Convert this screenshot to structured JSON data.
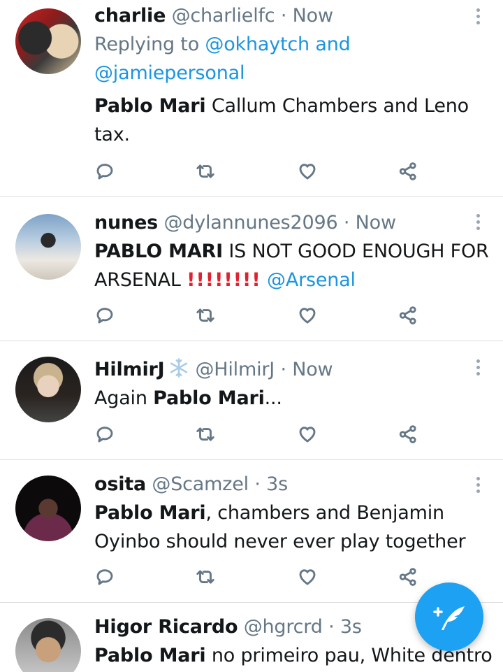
{
  "colors": {
    "accent": "#1da1f2",
    "link": "#1b95e0",
    "secondary": "#657786",
    "alert": "#e0212e"
  },
  "tweets": [
    {
      "name": "charlie",
      "handle": "@charlielfc",
      "time": "Now",
      "reply_prefix": "Replying to",
      "reply_to_1": "@okhaytch",
      "reply_and": "and",
      "reply_to_2": "@jamiepersonal",
      "bold": "Pablo Mari",
      "body_1": "Callum Chambers and Leno",
      "body_2": "tax."
    },
    {
      "name": "nunes",
      "handle": "@dylannunes2096",
      "time": "Now",
      "bold": "PABLO MARI",
      "body_1": "IS NOT GOOD ENOUGH FOR",
      "body_2": "ARSENAL",
      "excl": "!!!!!!!!",
      "mention": "@Arsenal"
    },
    {
      "name": "HilmirJ",
      "handle": "@HilmirJ",
      "time": "Now",
      "body_pre": "Again",
      "bold": "Pablo Mari",
      "body_post": "..."
    },
    {
      "name": "osita",
      "handle": "@Scamzel",
      "time": "3s",
      "bold": "Pablo Mari",
      "body_1": ", chambers and Benjamin",
      "body_2": "Oyinbo should never ever play together"
    },
    {
      "name": "Higor Ricardo",
      "handle": "@hgrcrd",
      "time": "3s",
      "bold": "Pablo Mari",
      "body_1": "no primeiro pau, White dentro"
    }
  ],
  "separator": "·",
  "icons": {
    "reply": "reply-icon",
    "retweet": "retweet-icon",
    "like": "heart-icon",
    "share": "share-icon",
    "more": "more-vertical-icon",
    "compose": "compose-tweet-icon",
    "verified_flair": "snowflake-icon"
  }
}
